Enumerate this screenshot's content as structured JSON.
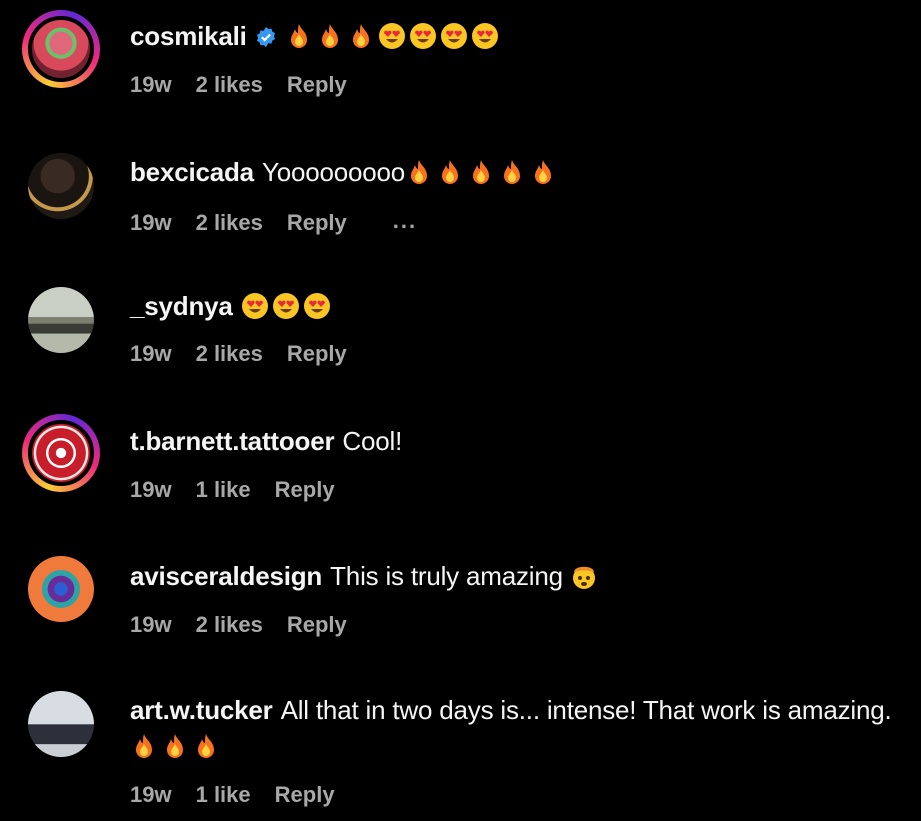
{
  "comments": [
    {
      "username": "cosmikali",
      "verified": true,
      "text": "",
      "emojis": [
        "fire",
        "fire",
        "fire",
        "heart-eyes",
        "heart-eyes",
        "heart-eyes",
        "heart-eyes"
      ],
      "age": "19w",
      "likes": "2 likes",
      "reply": "Reply"
    },
    {
      "username": "bexcicada",
      "text": "Yooooooooo",
      "emojis": [
        "fire",
        "fire",
        "fire",
        "fire",
        "fire"
      ],
      "age": "19w",
      "likes": "2 likes",
      "reply": "Reply",
      "more": "..."
    },
    {
      "username": "_sydnya",
      "text": "",
      "emojis": [
        "heart-eyes",
        "heart-eyes",
        "heart-eyes"
      ],
      "age": "19w",
      "likes": "2 likes",
      "reply": "Reply"
    },
    {
      "username": "t.barnett.tattooer",
      "text": "Cool!",
      "emojis": [],
      "age": "19w",
      "likes": "1 like",
      "reply": "Reply"
    },
    {
      "username": "avisceraldesign",
      "text": "This is truly amazing",
      "emojis": [
        "exploding-head"
      ],
      "age": "19w",
      "likes": "2 likes",
      "reply": "Reply"
    },
    {
      "username": "art.w.tucker",
      "text": "All that in two days is... intense! That work is amazing.",
      "emojis": [
        "fire",
        "fire",
        "fire"
      ],
      "age": "19w",
      "likes": "1 like",
      "reply": "Reply"
    }
  ],
  "colors": {
    "background": "#000000",
    "text": "#f5f5f5",
    "meta": "#a8a8a8",
    "verified": "#3897f0"
  }
}
